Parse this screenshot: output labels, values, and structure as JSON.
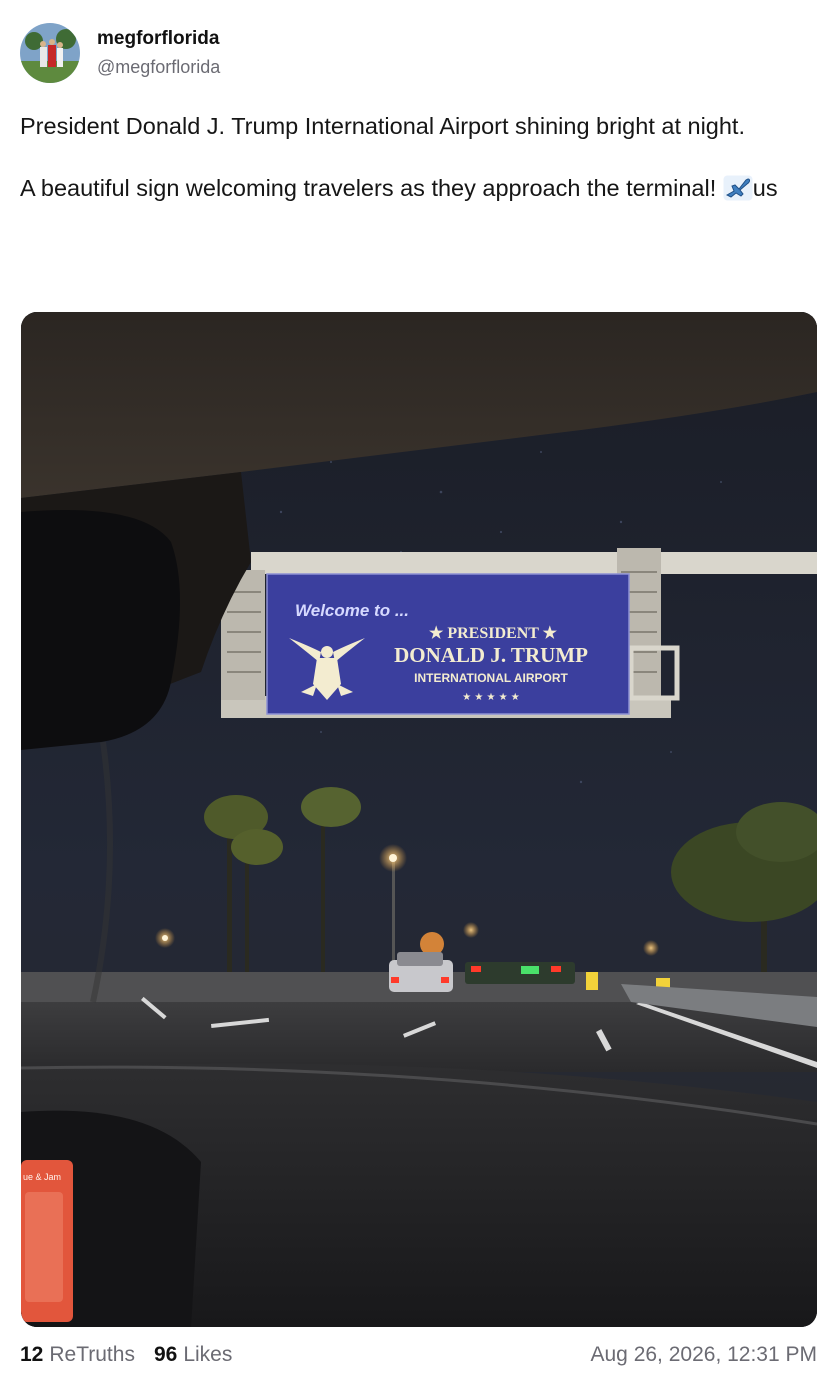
{
  "post": {
    "display_name": "megforflorida",
    "handle": "@megforflorida",
    "text_p1": "President Donald J. Trump International Airport shining bright at night.",
    "text_p2_pre": "A beautiful sign welcoming travelers as they approach the terminal!",
    "text_p2_post": "us",
    "emoji": "airplane",
    "timestamp": "Aug 26, 2026, 12:31 PM"
  },
  "stats": {
    "retruths_count": "12",
    "retruths_label": "ReTruths",
    "likes_count": "96",
    "likes_label": "Likes"
  },
  "photo_sign": {
    "welcome": "Welcome to ...",
    "line1": "★ PRESIDENT ★",
    "line2": "DONALD J. TRUMP",
    "line3": "INTERNATIONAL AIRPORT",
    "stars": "★ ★ ★ ★ ★"
  },
  "photo_misc": {
    "phone_label": "ue & Jam"
  },
  "colors": {
    "sign_blue": "#3b3f9e",
    "sign_text": "#f3ecd0",
    "muted_text": "#6b6b73"
  }
}
